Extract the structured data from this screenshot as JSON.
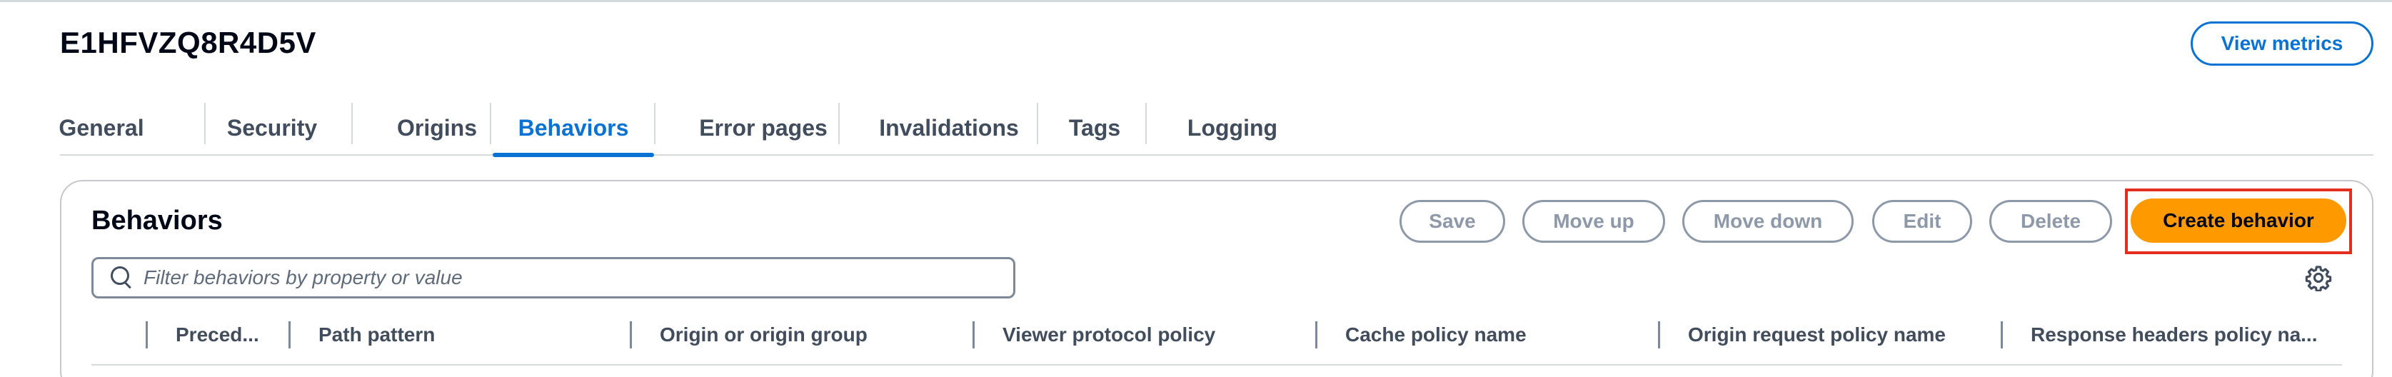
{
  "distribution": {
    "id": "E1HFVZQ8R4D5V"
  },
  "header": {
    "view_metrics_label": "View metrics"
  },
  "tabs": [
    {
      "label": "General"
    },
    {
      "label": "Security"
    },
    {
      "label": "Origins"
    },
    {
      "label": "Behaviors",
      "active": true
    },
    {
      "label": "Error pages"
    },
    {
      "label": "Invalidations"
    },
    {
      "label": "Tags"
    },
    {
      "label": "Logging"
    }
  ],
  "behaviors_panel": {
    "title": "Behaviors",
    "actions": {
      "save": "Save",
      "move_up": "Move up",
      "move_down": "Move down",
      "edit": "Edit",
      "delete": "Delete",
      "create": "Create behavior"
    },
    "filter": {
      "placeholder": "Filter behaviors by property or value"
    },
    "columns": [
      "Preced...",
      "Path pattern",
      "Origin or origin group",
      "Viewer protocol policy",
      "Cache policy name",
      "Origin request policy name",
      "Response headers policy na..."
    ]
  },
  "colors": {
    "accent_blue": "#0972d3",
    "create_orange": "#ff9900",
    "highlight_red": "#e22d1f",
    "disabled_gray": "#8d99a8"
  },
  "icons": [
    "search-icon",
    "gear-icon"
  ]
}
